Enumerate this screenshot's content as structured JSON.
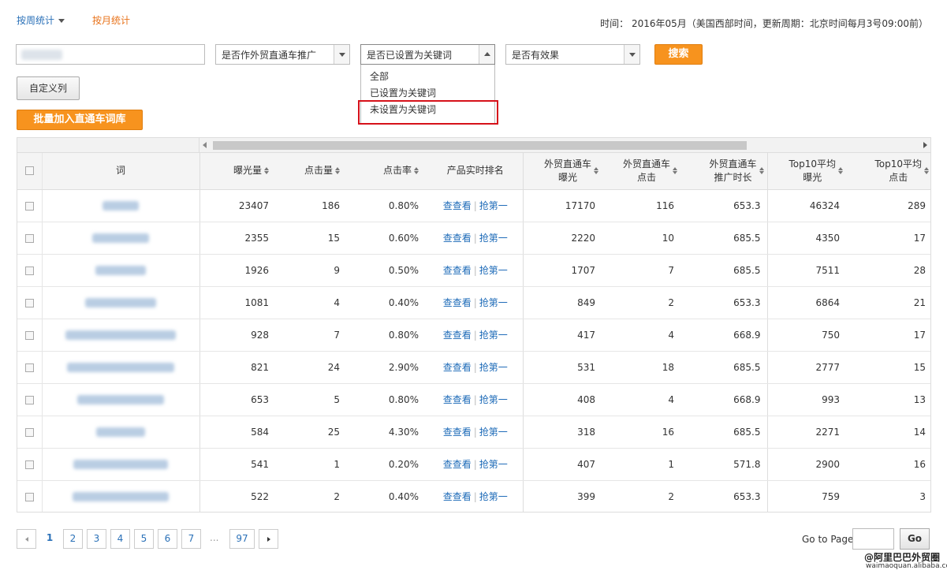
{
  "tabs": {
    "week": "按周统计",
    "month": "按月统计"
  },
  "time_info": "时间：  2016年05月（美国西部时间，更新周期：北京时间每月3号09:00前）",
  "filters": {
    "keyword_value": "",
    "promo_select": "是否作外贸直通车推广",
    "keyword_select": "是否已设置为关键词",
    "effect_select": "是否有效果",
    "search_label": "搜索",
    "dropdown_options": [
      "全部",
      "已设置为关键词",
      "未设置为关键词"
    ]
  },
  "buttons": {
    "custom_columns": "自定义列",
    "bulk_add": "批量加入直通车词库"
  },
  "table": {
    "headers": {
      "word": "词",
      "impressions": "曝光量",
      "clicks": "点击量",
      "ctr": "点击率",
      "rank": "产品实时排名",
      "p4p_imp_1": "外贸直通车",
      "p4p_imp_2": "曝光",
      "p4p_clk_1": "外贸直通车",
      "p4p_clk_2": "点击",
      "p4p_dur_1": "外贸直通车",
      "p4p_dur_2": "推广时长",
      "top10_imp_1": "Top10平均",
      "top10_imp_2": "曝光",
      "top10_clk_1": "Top10平均",
      "top10_clk_2": "点击"
    },
    "link_view": "查查看",
    "link_grab": "抢第一",
    "rows": [
      {
        "impressions": "23407",
        "clicks": "186",
        "ctr": "0.80%",
        "p4p_imp": "17170",
        "p4p_clk": "116",
        "p4p_dur": "653.3",
        "top10_imp": "46324",
        "top10_clk": "289"
      },
      {
        "impressions": "2355",
        "clicks": "15",
        "ctr": "0.60%",
        "p4p_imp": "2220",
        "p4p_clk": "10",
        "p4p_dur": "685.5",
        "top10_imp": "4350",
        "top10_clk": "17"
      },
      {
        "impressions": "1926",
        "clicks": "9",
        "ctr": "0.50%",
        "p4p_imp": "1707",
        "p4p_clk": "7",
        "p4p_dur": "685.5",
        "top10_imp": "7511",
        "top10_clk": "28"
      },
      {
        "impressions": "1081",
        "clicks": "4",
        "ctr": "0.40%",
        "p4p_imp": "849",
        "p4p_clk": "2",
        "p4p_dur": "653.3",
        "top10_imp": "6864",
        "top10_clk": "21"
      },
      {
        "impressions": "928",
        "clicks": "7",
        "ctr": "0.80%",
        "p4p_imp": "417",
        "p4p_clk": "4",
        "p4p_dur": "668.9",
        "top10_imp": "750",
        "top10_clk": "17"
      },
      {
        "impressions": "821",
        "clicks": "24",
        "ctr": "2.90%",
        "p4p_imp": "531",
        "p4p_clk": "18",
        "p4p_dur": "685.5",
        "top10_imp": "2777",
        "top10_clk": "15"
      },
      {
        "impressions": "653",
        "clicks": "5",
        "ctr": "0.80%",
        "p4p_imp": "408",
        "p4p_clk": "4",
        "p4p_dur": "668.9",
        "top10_imp": "993",
        "top10_clk": "13"
      },
      {
        "impressions": "584",
        "clicks": "25",
        "ctr": "4.30%",
        "p4p_imp": "318",
        "p4p_clk": "16",
        "p4p_dur": "685.5",
        "top10_imp": "2271",
        "top10_clk": "14"
      },
      {
        "impressions": "541",
        "clicks": "1",
        "ctr": "0.20%",
        "p4p_imp": "407",
        "p4p_clk": "1",
        "p4p_dur": "571.8",
        "top10_imp": "2900",
        "top10_clk": "16"
      },
      {
        "impressions": "522",
        "clicks": "2",
        "ctr": "0.40%",
        "p4p_imp": "399",
        "p4p_clk": "2",
        "p4p_dur": "653.3",
        "top10_imp": "759",
        "top10_clk": "3"
      }
    ]
  },
  "pager": {
    "pages": [
      "1",
      "2",
      "3",
      "4",
      "5",
      "6",
      "7"
    ],
    "dots": "...",
    "last": "97",
    "current": "1"
  },
  "goto": {
    "label": "Go to Page",
    "value": "",
    "button": "Go"
  },
  "watermark": {
    "line1": "@阿里巴巴外贸圈",
    "line2": "waimaoquan.alibaba.com"
  },
  "colors": {
    "accent_orange": "#f7931e",
    "link_blue": "#1e6bb8",
    "highlight_red": "#d6111a"
  }
}
